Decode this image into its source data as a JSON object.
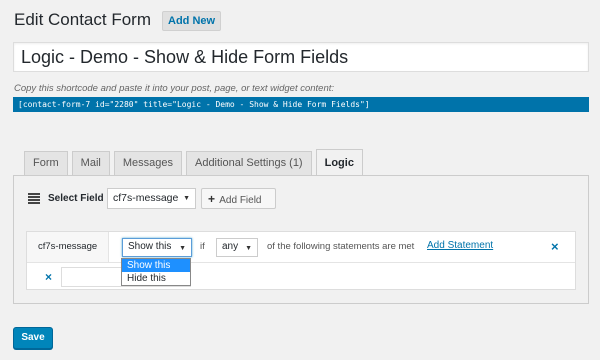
{
  "header": {
    "title": "Edit Contact Form",
    "add_new_label": "Add New"
  },
  "form_title": {
    "value": "Logic - Demo - Show & Hide Form Fields"
  },
  "shortcode": {
    "help_text": "Copy this shortcode and paste it into your post, page, or text widget content:",
    "code": "[contact-form-7 id=\"2280\" title=\"Logic - Demo - Show & Hide Form Fields\"]"
  },
  "tabs": [
    {
      "label": "Form",
      "active": false
    },
    {
      "label": "Mail",
      "active": false
    },
    {
      "label": "Messages",
      "active": false
    },
    {
      "label": "Additional Settings (1)",
      "active": false
    },
    {
      "label": "Logic",
      "active": true
    }
  ],
  "logic": {
    "select_field_label": "Select Field",
    "selected_field": "cf7s-message",
    "add_field_label": "Add Field",
    "rule": {
      "field_name": "cf7s-message",
      "action_value": "Show this",
      "if_label": "if",
      "match_value": "any",
      "statements_text": "of the following statements are met",
      "add_statement_label": "Add Statement",
      "remove_icon": "×",
      "statement_value": ""
    },
    "action_dropdown": {
      "options": [
        "Show this",
        "Hide this"
      ],
      "highlighted": "Show this"
    }
  },
  "footer": {
    "save_label": "Save"
  },
  "colors": {
    "accent": "#0073aa",
    "primary_button": "#0085ba",
    "dropdown_highlight": "#1e90ff"
  }
}
